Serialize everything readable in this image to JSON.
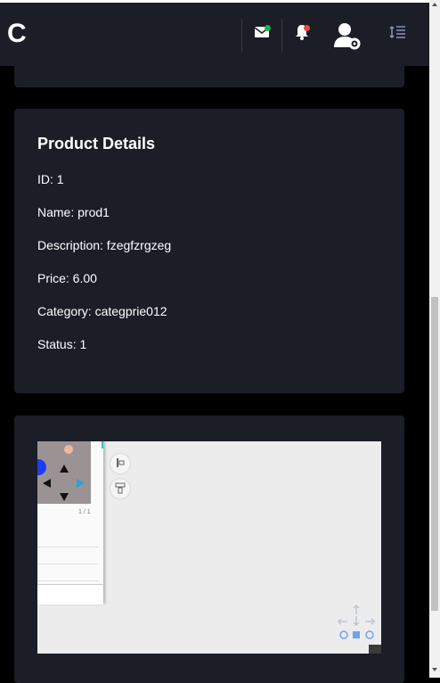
{
  "header": {
    "logo": "C",
    "icons": [
      "mail-icon",
      "bell-icon",
      "user-settings-icon",
      "menu-toggle-icon"
    ],
    "mail_dot_color": "#19b24b",
    "bell_dot_color": "#e74c3c"
  },
  "product_details": {
    "title": "Product Details",
    "rows": [
      "ID: 1",
      "Name: prod1",
      "Description: fzegfzrgzeg",
      "Price: 6.00",
      "Category: categprie012",
      "Status: 1"
    ]
  },
  "map": {
    "panel_page": "1 / 1"
  }
}
